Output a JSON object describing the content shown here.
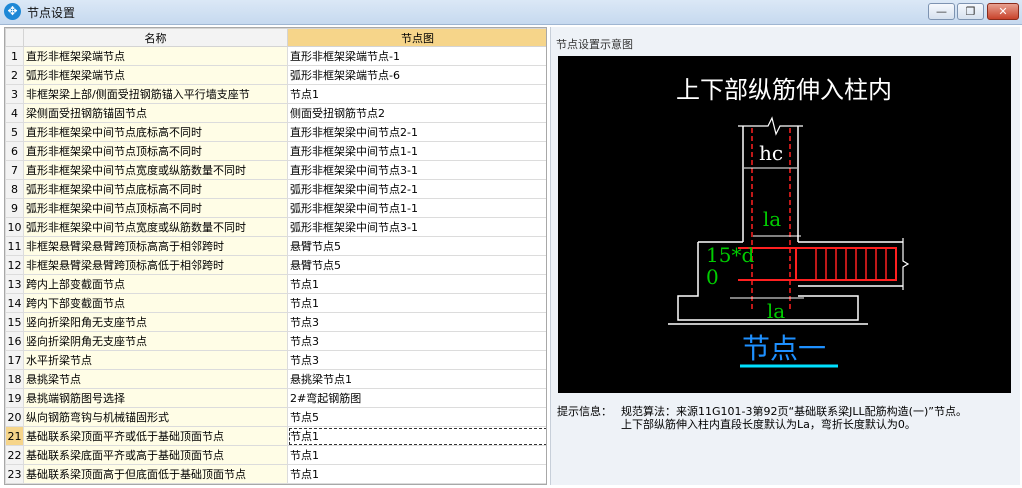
{
  "window": {
    "title": "节点设置",
    "buttons": {
      "min": "—",
      "max": "❐",
      "close": "✕"
    }
  },
  "table": {
    "headers": {
      "name": "名称",
      "value": "节点图"
    },
    "selected_row": 21,
    "rows": [
      {
        "num": "1",
        "name": "直形非框架梁端节点",
        "value": "直形非框架梁端节点-1"
      },
      {
        "num": "2",
        "name": "弧形非框架梁端节点",
        "value": "弧形非框架梁端节点-6"
      },
      {
        "num": "3",
        "name": "非框架梁上部/侧面受扭钢筋锚入平行墙支座节",
        "value": "节点1"
      },
      {
        "num": "4",
        "name": "梁侧面受扭钢筋锚固节点",
        "value": "侧面受扭钢筋节点2"
      },
      {
        "num": "5",
        "name": "直形非框架梁中间节点底标高不同时",
        "value": "直形非框架梁中间节点2-1"
      },
      {
        "num": "6",
        "name": "直形非框架梁中间节点顶标高不同时",
        "value": "直形非框架梁中间节点1-1"
      },
      {
        "num": "7",
        "name": "直形非框架梁中间节点宽度或纵筋数量不同时",
        "value": "直形非框架梁中间节点3-1"
      },
      {
        "num": "8",
        "name": "弧形非框架梁中间节点底标高不同时",
        "value": "弧形非框架梁中间节点2-1"
      },
      {
        "num": "9",
        "name": "弧形非框架梁中间节点顶标高不同时",
        "value": "弧形非框架梁中间节点1-1"
      },
      {
        "num": "10",
        "name": "弧形非框架梁中间节点宽度或纵筋数量不同时",
        "value": "弧形非框架梁中间节点3-1"
      },
      {
        "num": "11",
        "name": "非框架悬臂梁悬臂跨顶标高高于相邻跨时",
        "value": "悬臂节点5"
      },
      {
        "num": "12",
        "name": "非框架悬臂梁悬臂跨顶标高低于相邻跨时",
        "value": "悬臂节点5"
      },
      {
        "num": "13",
        "name": "跨内上部变截面节点",
        "value": "节点1"
      },
      {
        "num": "14",
        "name": "跨内下部变截面节点",
        "value": "节点1"
      },
      {
        "num": "15",
        "name": "竖向折梁阳角无支座节点",
        "value": "节点3"
      },
      {
        "num": "16",
        "name": "竖向折梁阴角无支座节点",
        "value": "节点3"
      },
      {
        "num": "17",
        "name": "水平折梁节点",
        "value": "节点3"
      },
      {
        "num": "18",
        "name": "悬挑梁节点",
        "value": "悬挑梁节点1"
      },
      {
        "num": "19",
        "name": "悬挑端钢筋图号选择",
        "value": "2#弯起钢筋图"
      },
      {
        "num": "20",
        "name": "纵向钢筋弯钩与机械锚固形式",
        "value": "节点5"
      },
      {
        "num": "21",
        "name": "基础联系梁顶面平齐或低于基础顶面节点",
        "value": "节点1"
      },
      {
        "num": "22",
        "name": "基础联系梁底面平齐或高于基础顶面节点",
        "value": "节点1"
      },
      {
        "num": "23",
        "name": "基础联系梁顶面高于但底面低于基础顶面节点",
        "value": "节点1"
      }
    ]
  },
  "preview": {
    "label": "节点设置示意图",
    "diagram_title": "上下部纵筋伸入柱内",
    "dims": {
      "hc": "hc",
      "la_top": "la",
      "left_top": "15*d",
      "left_zero": "0",
      "la_bottom": "la"
    },
    "node_caption": "节点一",
    "colors": {
      "bg": "#000000",
      "frame": "#ffffff",
      "rebar": "#ff0000",
      "dim": "#00cc00",
      "caption": "#1e90ff"
    }
  },
  "info": {
    "label": "提示信息：",
    "line1": "规范算法：来源11G101-3第92页“基础联系梁JLL配筋构造(一)”节点。",
    "line2": "上下部纵筋伸入柱内直段长度默认为La，弯折长度默认为0。"
  }
}
